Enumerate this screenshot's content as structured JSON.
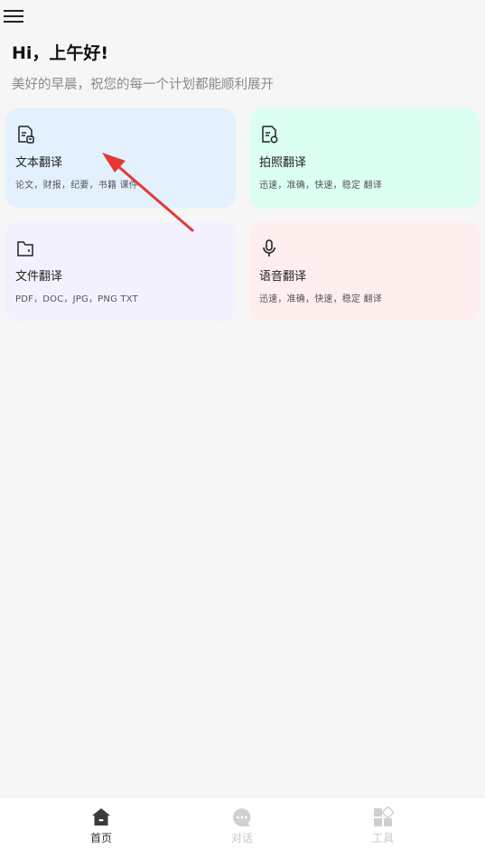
{
  "header": {
    "menu_icon": "hamburger-menu-icon",
    "greeting": "Hi，上午好!",
    "subtitle": "美好的早晨，祝您的每一个计划都能顺利展开"
  },
  "cards": [
    {
      "title": "文本翻译",
      "desc": "论文，财报，纪要，书籍 课件",
      "icon": "document-icon",
      "color": "#e3f1ff"
    },
    {
      "title": "拍照翻译",
      "desc": "迅速，准确，快速，稳定 翻译",
      "icon": "photo-document-icon",
      "color": "#dbfff0"
    },
    {
      "title": "文件翻译",
      "desc": "PDF，DOC，JPG，PNG TXT",
      "icon": "folder-icon",
      "color": "#f4f1ff"
    },
    {
      "title": "语音翻译",
      "desc": "迅速，准确，快速，稳定 翻译",
      "icon": "microphone-icon",
      "color": "#ffeeee"
    }
  ],
  "annotation": {
    "icon": "red-arrow-icon",
    "color": "#e53935"
  },
  "tabbar": {
    "tabs": [
      {
        "label": "首页",
        "icon": "home-icon",
        "active": true
      },
      {
        "label": "对话",
        "icon": "chat-icon",
        "active": false
      },
      {
        "label": "工具",
        "icon": "tools-grid-icon",
        "active": false
      }
    ]
  }
}
